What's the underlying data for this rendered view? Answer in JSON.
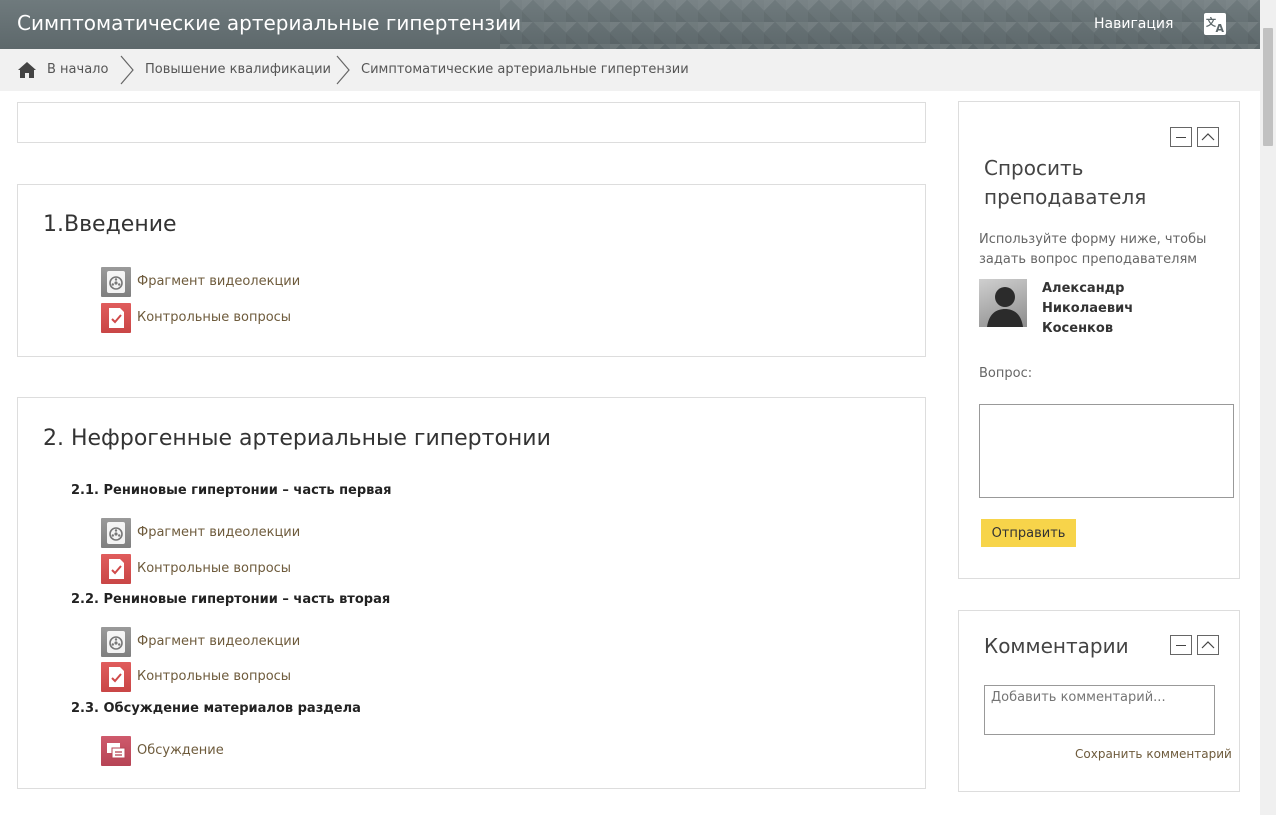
{
  "header": {
    "title": "Симптоматические артериальные гипертензии",
    "nav_label": "Навигация",
    "language_icon": "translate-icon"
  },
  "breadcrumb": {
    "items": [
      "В начало",
      "Повышение квалификации",
      "Симптоматические артериальные гипертензии"
    ]
  },
  "sections": [
    {
      "title": "1.Введение",
      "activities": [
        {
          "label": "Фрагмент видеолекции",
          "icon": "video-icon"
        },
        {
          "label": "Контрольные вопросы",
          "icon": "quiz-icon"
        }
      ]
    },
    {
      "title": "2. Нефрогенные артериальные гипертонии",
      "subsections": [
        {
          "title": "2.1. Рениновые гипертонии – часть первая",
          "activities": [
            {
              "label": "Фрагмент видеолекции",
              "icon": "video-icon"
            },
            {
              "label": "Контрольные вопросы",
              "icon": "quiz-icon"
            }
          ]
        },
        {
          "title": "2.2. Рениновые гипертонии – часть вторая",
          "activities": [
            {
              "label": "Фрагмент видеолекции",
              "icon": "video-icon"
            },
            {
              "label": "Контрольные вопросы",
              "icon": "quiz-icon"
            }
          ]
        },
        {
          "title": "2.3. Обсуждение материалов раздела",
          "activities": [
            {
              "label": "Обсуждение",
              "icon": "forum-icon"
            }
          ]
        }
      ]
    }
  ],
  "ask_block": {
    "title": "Спросить преподавателя",
    "description": "Используйте форму ниже, чтобы задать вопрос преподавателям",
    "teacher_name": "Александр Николаевич Косенков",
    "question_label": "Вопрос:",
    "send_label": "Отправить"
  },
  "comments_block": {
    "title": "Комментарии",
    "placeholder": "Добавить комментарий...",
    "save_label": "Сохранить комментарий"
  },
  "colors": {
    "header_bg": "#5d686b",
    "link": "#6e5b3c",
    "send_button": "#f7d44a"
  }
}
